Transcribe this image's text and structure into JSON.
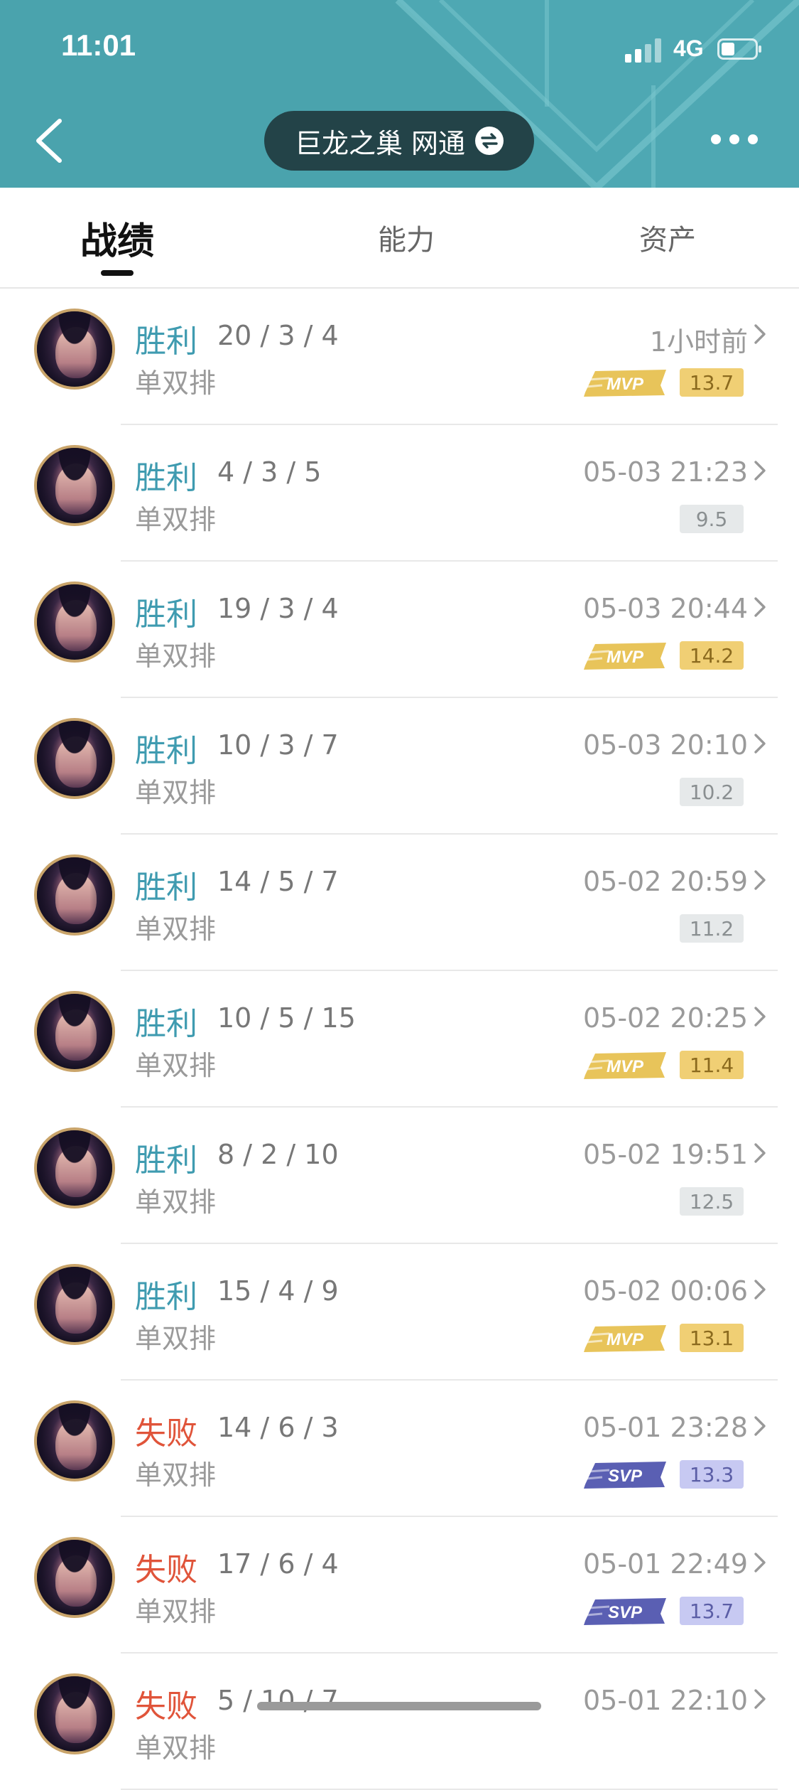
{
  "status_bar": {
    "time": "11:01",
    "network": "4G"
  },
  "header": {
    "server": "巨龙之巢 网通"
  },
  "tabs": [
    {
      "label": "战绩",
      "active": true
    },
    {
      "label": "能力",
      "active": false
    },
    {
      "label": "资产",
      "active": false
    }
  ],
  "colors": {
    "win": "#3f9bb0",
    "loss": "#e0543a",
    "mvp": "#f0cf74",
    "svp": "#c7c9f2",
    "header": "#4aa3ad"
  },
  "matches": [
    {
      "result": "胜利",
      "outcome": "win",
      "kda": "20 / 3 / 4",
      "mode": "单双排",
      "time": "1小时前",
      "badge": "MVP",
      "score": "13.7"
    },
    {
      "result": "胜利",
      "outcome": "win",
      "kda": "4 / 3 / 5",
      "mode": "单双排",
      "time": "05-03 21:23",
      "badge": "",
      "score": "9.5"
    },
    {
      "result": "胜利",
      "outcome": "win",
      "kda": "19 / 3 / 4",
      "mode": "单双排",
      "time": "05-03 20:44",
      "badge": "MVP",
      "score": "14.2"
    },
    {
      "result": "胜利",
      "outcome": "win",
      "kda": "10 / 3 / 7",
      "mode": "单双排",
      "time": "05-03 20:10",
      "badge": "",
      "score": "10.2"
    },
    {
      "result": "胜利",
      "outcome": "win",
      "kda": "14 / 5 / 7",
      "mode": "单双排",
      "time": "05-02 20:59",
      "badge": "",
      "score": "11.2"
    },
    {
      "result": "胜利",
      "outcome": "win",
      "kda": "10 / 5 / 15",
      "mode": "单双排",
      "time": "05-02 20:25",
      "badge": "MVP",
      "score": "11.4"
    },
    {
      "result": "胜利",
      "outcome": "win",
      "kda": "8 / 2 / 10",
      "mode": "单双排",
      "time": "05-02 19:51",
      "badge": "",
      "score": "12.5"
    },
    {
      "result": "胜利",
      "outcome": "win",
      "kda": "15 / 4 / 9",
      "mode": "单双排",
      "time": "05-02 00:06",
      "badge": "MVP",
      "score": "13.1"
    },
    {
      "result": "失败",
      "outcome": "loss",
      "kda": "14 / 6 / 3",
      "mode": "单双排",
      "time": "05-01 23:28",
      "badge": "SVP",
      "score": "13.3"
    },
    {
      "result": "失败",
      "outcome": "loss",
      "kda": "17 / 6 / 4",
      "mode": "单双排",
      "time": "05-01 22:49",
      "badge": "SVP",
      "score": "13.7"
    },
    {
      "result": "失败",
      "outcome": "loss",
      "kda": "5 / 10 / 7",
      "mode": "单双排",
      "time": "05-01 22:10",
      "badge": "",
      "score": ""
    }
  ]
}
